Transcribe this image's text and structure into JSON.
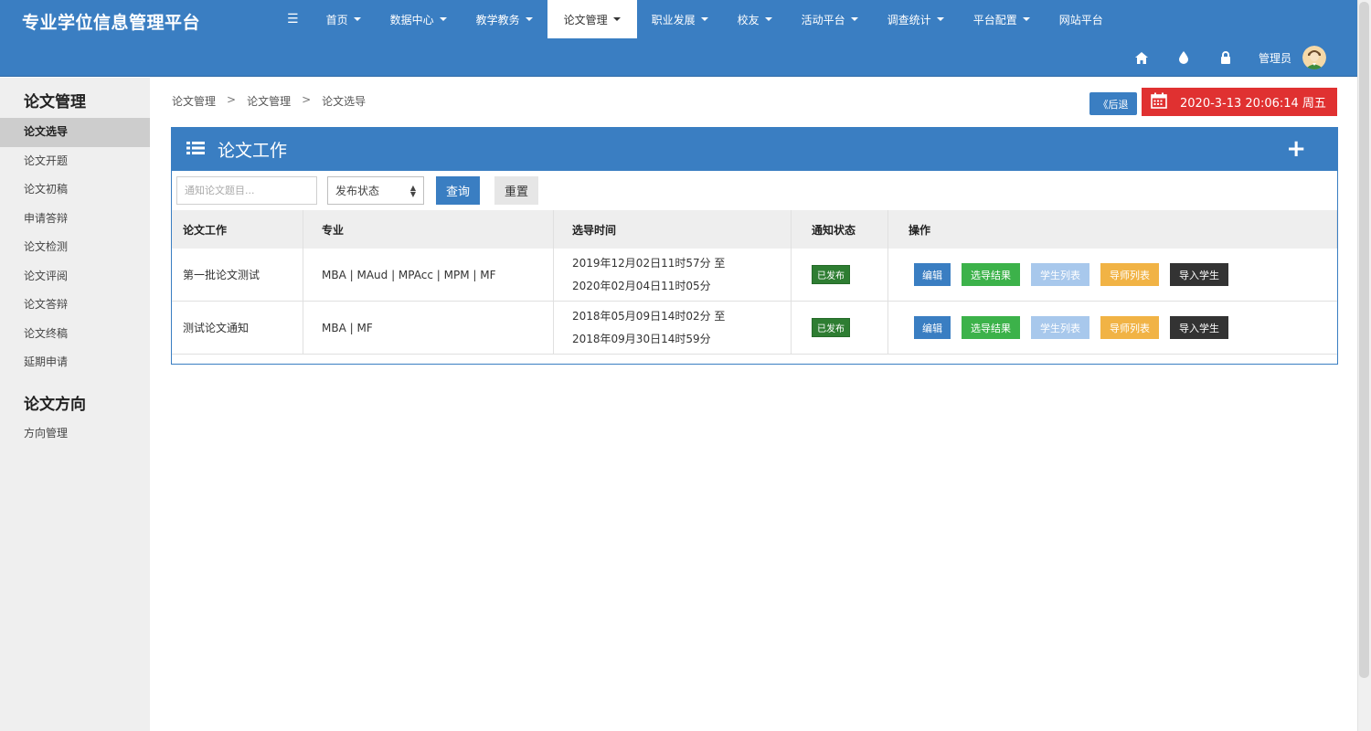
{
  "brand": "专业学位信息管理平台",
  "nav": [
    {
      "label": "首页",
      "caret": true
    },
    {
      "label": "数据中心",
      "caret": true
    },
    {
      "label": "教学教务",
      "caret": true
    },
    {
      "label": "论文管理",
      "caret": true,
      "active": true
    },
    {
      "label": "职业发展",
      "caret": true
    },
    {
      "label": "校友",
      "caret": true
    },
    {
      "label": "活动平台",
      "caret": true
    },
    {
      "label": "调查统计",
      "caret": true
    },
    {
      "label": "平台配置",
      "caret": true
    },
    {
      "label": "网站平台",
      "caret": false
    }
  ],
  "toolbar": {
    "admin": "管理员"
  },
  "sidebar": {
    "section1": "论文管理",
    "items1": [
      "论文选导",
      "论文开题",
      "论文初稿",
      "申请答辩",
      "论文检测",
      "论文评阅",
      "论文答辩",
      "论文终稿",
      "延期申请"
    ],
    "section2": "论文方向",
    "items2": [
      "方向管理"
    ]
  },
  "breadcrumb": [
    "论文管理",
    "论文管理",
    "论文选导"
  ],
  "back_label": "《后退",
  "datetime": "2020-3-13 20:06:14 周五",
  "panel": {
    "title": "论文工作"
  },
  "filters": {
    "search_placeholder": "通知论文题目...",
    "status_select": "发布状态",
    "query": "查询",
    "reset": "重置"
  },
  "table": {
    "headers": [
      "论文工作",
      "专业",
      "选导时间",
      "通知状态",
      "操作"
    ],
    "rows": [
      {
        "name": "第一批论文测试",
        "major": "MBA | MAud | MPAcc | MPM | MF",
        "time_from": "2019年12月02日11时57分 至",
        "time_to": "2020年02月04日11时05分",
        "status": "已发布"
      },
      {
        "name": "测试论文通知",
        "major": "MBA | MF",
        "time_from": "2018年05月09日14时02分 至",
        "time_to": "2018年09月30日14时59分",
        "status": "已发布"
      }
    ],
    "actions": {
      "edit": "编辑",
      "result": "选导结果",
      "students": "学生列表",
      "mentors": "导师列表",
      "import": "导入学生"
    }
  },
  "colors": {
    "primary": "#3a7ec2",
    "danger": "#e03131",
    "success": "#3cb24a",
    "warning": "#f1b345",
    "dark": "#333333",
    "light_blue": "#a8c8ec"
  }
}
